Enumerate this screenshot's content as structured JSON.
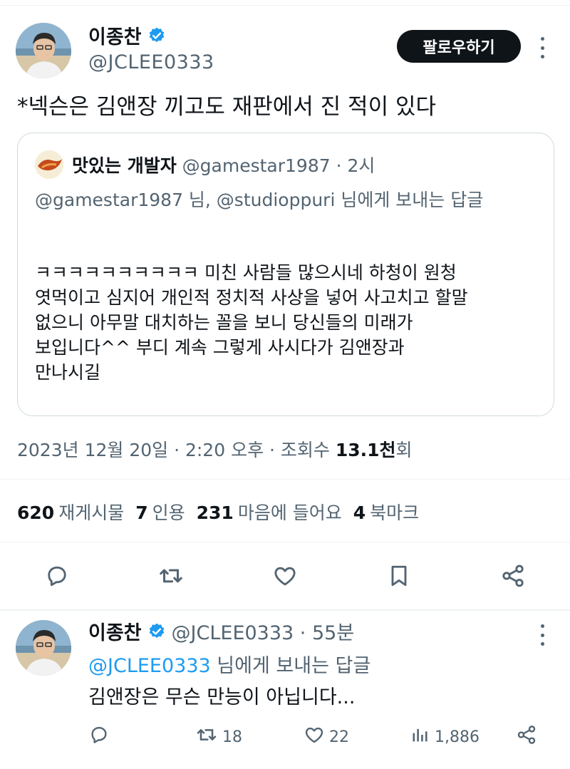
{
  "main_tweet": {
    "author": {
      "name": "이종찬",
      "handle": "@JCLEE0333"
    },
    "follow_label": "팔로우하기",
    "text": "*넥슨은 김앤장 끼고도 재판에서 진 적이 있다",
    "quote": {
      "author_name": "맛있는 개발자",
      "meta": "@gamestar1987 · 2시",
      "reply_to": "@gamestar1987 님, @studioppuri 님에게 보내는 답글",
      "body_lines": [
        "ㅋㅋㅋㅋㅋㅋㅋㅋㅋㅋ 미친 사람들 많으시네 하청이 원청",
        "엿먹이고 심지어 개인적 정치적 사상을 넣어 사고치고 할말",
        "없으니 아무말 대치하는 꼴을 보니 당신들의 미래가",
        "보입니다^^ 부디 계속 그렇게 사시다가 김앤장과",
        "만나시길"
      ]
    },
    "timestamp": {
      "prefix": "2023년 12월 20일 · 2:20 오후 · 조회수 ",
      "views": "13.1천",
      "suffix": "회"
    },
    "stats": [
      {
        "num": "620",
        "label": "재게시물"
      },
      {
        "num": "7",
        "label": "인용"
      },
      {
        "num": "231",
        "label": "마음에 들어요"
      },
      {
        "num": "4",
        "label": "북마크"
      }
    ],
    "actions": [
      "reply-icon",
      "retweet-icon",
      "like-icon",
      "bookmark-icon",
      "share-icon"
    ]
  },
  "reply_tweet": {
    "author": {
      "name": "이종찬",
      "meta": "@JCLEE0333 · 55분"
    },
    "reply_to_mention": "@JCLEE0333",
    "reply_to_suffix": " 님에게 보내는 답글",
    "text": "김앤장은 무슨 만능이 아닙니다...",
    "counts": {
      "replies": "",
      "retweets": "18",
      "likes": "22",
      "views": "1,886"
    }
  },
  "colors": {
    "accent": "#1d9bf0",
    "text": "#0f1419",
    "muted": "#536471",
    "border": "#cfd9de"
  }
}
